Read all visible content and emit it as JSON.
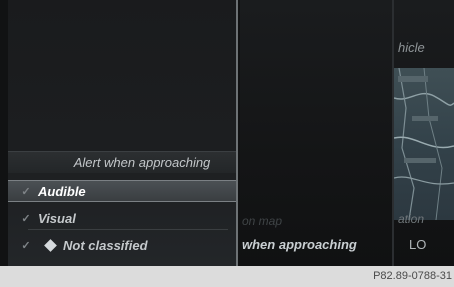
{
  "menu": {
    "title": "Alert when approaching",
    "items": [
      {
        "label": "Audible",
        "checked": true,
        "selected": true
      },
      {
        "label": "Visual",
        "checked": true,
        "selected": false
      },
      {
        "label": "Not classified",
        "checked": true,
        "selected": false
      }
    ]
  },
  "background": {
    "right_header": "hicle",
    "mid_label_faded": "on map",
    "mid_label": "when approaching",
    "right_bottom_label": "ation",
    "right_value": "LO"
  },
  "footer": {
    "image_code": "P82.89-0788-31"
  },
  "colors": {
    "selected_bg": "#4b5054",
    "menu_bg": "#1c1e20",
    "screen_bg": "#111213",
    "footer_bg": "#dcdcdc"
  }
}
